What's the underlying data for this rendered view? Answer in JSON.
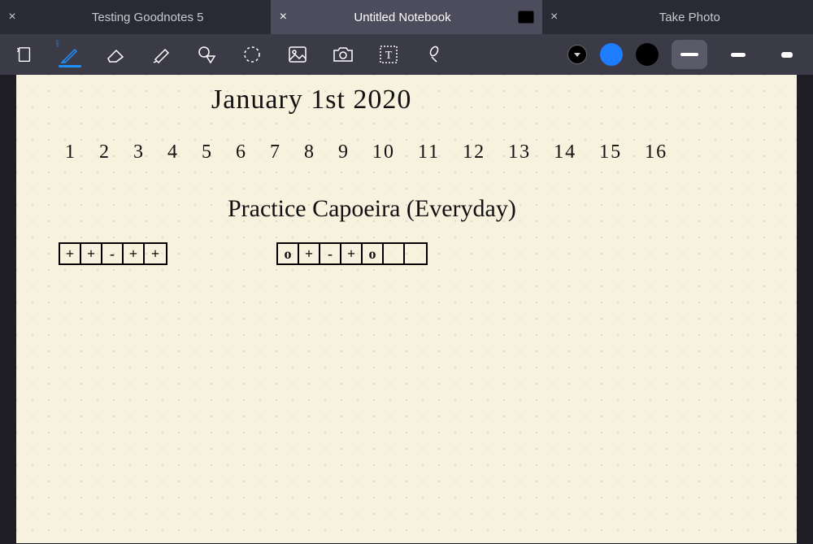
{
  "tabs": [
    {
      "title": "Testing Goodnotes 5",
      "active": false
    },
    {
      "title": "Untitled Notebook",
      "active": true
    },
    {
      "title": "Take Photo",
      "active": false
    }
  ],
  "tools": {
    "page_nav": "page-nav-icon",
    "pen": "pen-icon",
    "eraser": "eraser-icon",
    "highlighter": "highlighter-icon",
    "shape": "shape-icon",
    "lasso": "lasso-icon",
    "image": "image-icon",
    "camera": "camera-icon",
    "text": "text-icon",
    "link": "link-icon"
  },
  "color_swatches": {
    "current": "#1e7cff",
    "alt": "#000000"
  },
  "stroke_widths": [
    "thin",
    "medium",
    "thick"
  ],
  "selected_stroke": "thin",
  "note": {
    "title": "January 1st 2020",
    "numbers": [
      "1",
      "2",
      "3",
      "4",
      "5",
      "6",
      "7",
      "8",
      "9",
      "10",
      "11",
      "12",
      "13",
      "14",
      "15",
      "16"
    ],
    "subtitle": "Practice Capoeira (Everyday)",
    "tracker_row_1": [
      "+",
      "+",
      "-",
      "+",
      "+"
    ],
    "tracker_row_2": [
      "o",
      "+",
      "-",
      "+",
      "o",
      "",
      ""
    ]
  }
}
